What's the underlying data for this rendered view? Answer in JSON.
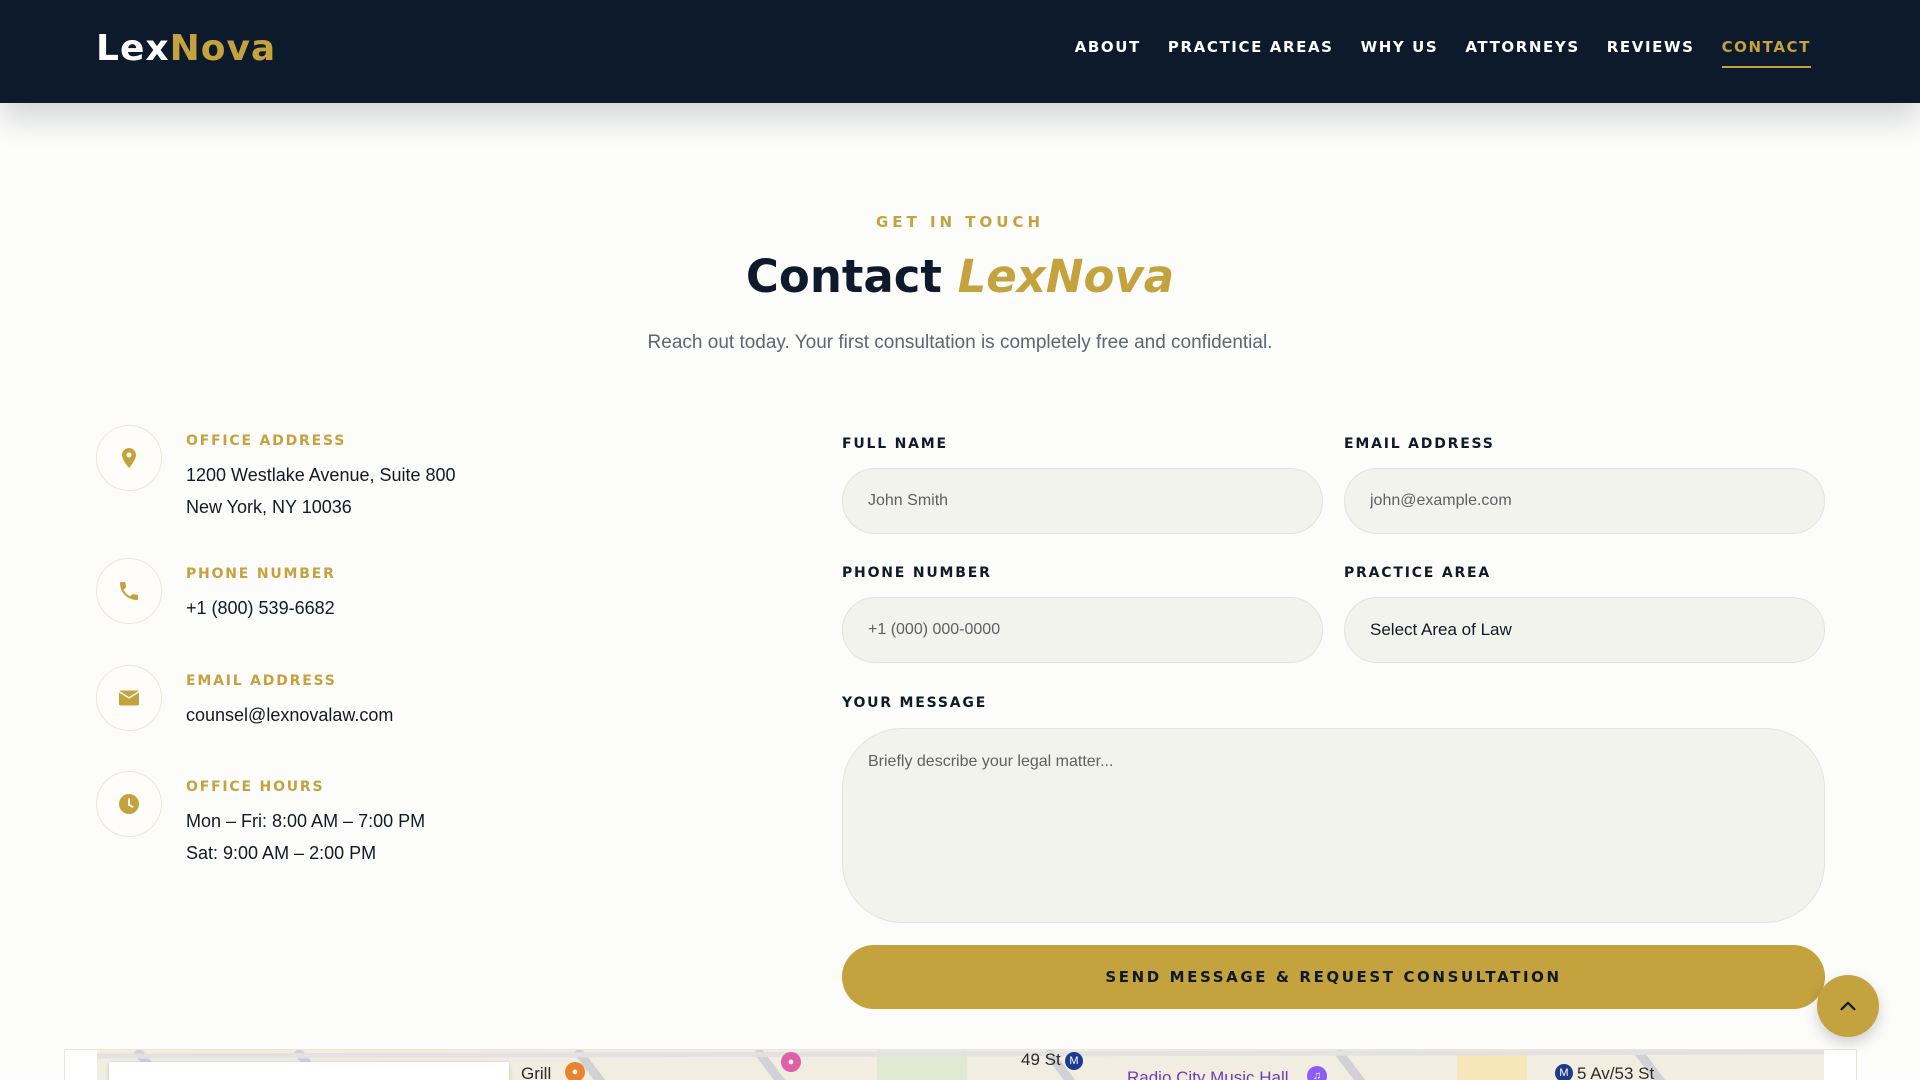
{
  "brand": {
    "name_part1": "Lex",
    "name_part2": "Nova",
    "accent_color": "#c4a23e",
    "navy_color": "#0d1a2c"
  },
  "nav": {
    "items": [
      {
        "label": "ABOUT",
        "active": false
      },
      {
        "label": "PRACTICE AREAS",
        "active": false
      },
      {
        "label": "WHY US",
        "active": false
      },
      {
        "label": "ATTORNEYS",
        "active": false
      },
      {
        "label": "REVIEWS",
        "active": false
      },
      {
        "label": "CONTACT",
        "active": true
      }
    ]
  },
  "section": {
    "eyebrow": "GET IN TOUCH",
    "title_plain": "Contact",
    "title_accent": "LexNova",
    "subtitle": "Reach out today. Your first consultation is completely free and confidential."
  },
  "info": {
    "address": {
      "label": "OFFICE ADDRESS",
      "line1": "1200 Westlake Avenue, Suite 800",
      "line2": "New York, NY 10036",
      "icon": "map-pin-icon"
    },
    "phone": {
      "label": "PHONE NUMBER",
      "line1": "+1 (800) 539-6682",
      "icon": "phone-icon"
    },
    "email": {
      "label": "EMAIL ADDRESS",
      "line1": "counsel@lexnovalaw.com",
      "icon": "envelope-icon"
    },
    "hours": {
      "label": "OFFICE HOURS",
      "line1": "Mon – Fri: 8:00 AM – 7:00 PM",
      "line2": "Sat: 9:00 AM – 2:00 PM",
      "icon": "clock-icon"
    }
  },
  "form": {
    "full_name": {
      "label": "FULL NAME",
      "placeholder": "John Smith",
      "value": ""
    },
    "email": {
      "label": "EMAIL ADDRESS",
      "placeholder": "john@example.com",
      "value": ""
    },
    "phone": {
      "label": "PHONE NUMBER",
      "placeholder": "+1 (000) 000-0000",
      "value": ""
    },
    "practice_area": {
      "label": "PRACTICE AREA",
      "selected": "Select Area of Law"
    },
    "message": {
      "label": "YOUR MESSAGE",
      "placeholder": "Briefly describe your legal matter...",
      "value": ""
    },
    "submit_label": "SEND MESSAGE & REQUEST CONSULTATION"
  },
  "back_to_top": {
    "icon": "chevron-up-icon"
  },
  "map": {
    "labels": [
      "Grill",
      "49 St",
      "Radio City Music Hall",
      "5 Av/53 St"
    ]
  }
}
